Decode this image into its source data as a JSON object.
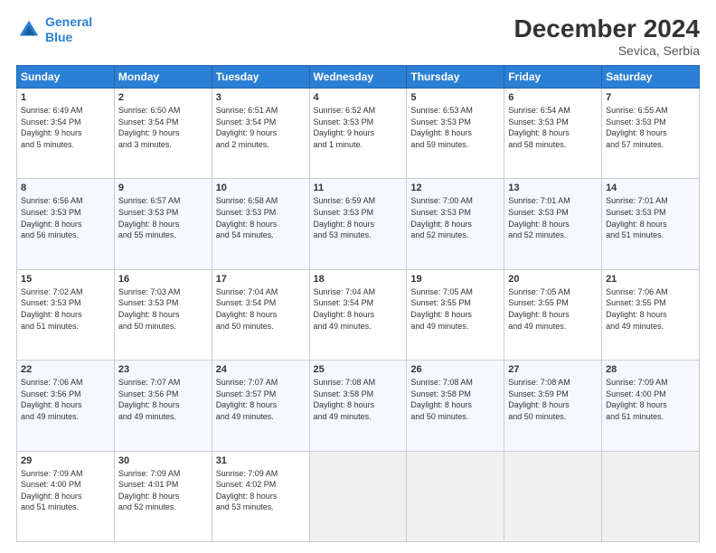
{
  "header": {
    "logo_line1": "General",
    "logo_line2": "Blue",
    "title": "December 2024",
    "subtitle": "Sevica, Serbia"
  },
  "days_of_week": [
    "Sunday",
    "Monday",
    "Tuesday",
    "Wednesday",
    "Thursday",
    "Friday",
    "Saturday"
  ],
  "weeks": [
    [
      {
        "day": 1,
        "info": "Sunrise: 6:49 AM\nSunset: 3:54 PM\nDaylight: 9 hours\nand 5 minutes."
      },
      {
        "day": 2,
        "info": "Sunrise: 6:50 AM\nSunset: 3:54 PM\nDaylight: 9 hours\nand 3 minutes."
      },
      {
        "day": 3,
        "info": "Sunrise: 6:51 AM\nSunset: 3:54 PM\nDaylight: 9 hours\nand 2 minutes."
      },
      {
        "day": 4,
        "info": "Sunrise: 6:52 AM\nSunset: 3:53 PM\nDaylight: 9 hours\nand 1 minute."
      },
      {
        "day": 5,
        "info": "Sunrise: 6:53 AM\nSunset: 3:53 PM\nDaylight: 8 hours\nand 59 minutes."
      },
      {
        "day": 6,
        "info": "Sunrise: 6:54 AM\nSunset: 3:53 PM\nDaylight: 8 hours\nand 58 minutes."
      },
      {
        "day": 7,
        "info": "Sunrise: 6:55 AM\nSunset: 3:53 PM\nDaylight: 8 hours\nand 57 minutes."
      }
    ],
    [
      {
        "day": 8,
        "info": "Sunrise: 6:56 AM\nSunset: 3:53 PM\nDaylight: 8 hours\nand 56 minutes."
      },
      {
        "day": 9,
        "info": "Sunrise: 6:57 AM\nSunset: 3:53 PM\nDaylight: 8 hours\nand 55 minutes."
      },
      {
        "day": 10,
        "info": "Sunrise: 6:58 AM\nSunset: 3:53 PM\nDaylight: 8 hours\nand 54 minutes."
      },
      {
        "day": 11,
        "info": "Sunrise: 6:59 AM\nSunset: 3:53 PM\nDaylight: 8 hours\nand 53 minutes."
      },
      {
        "day": 12,
        "info": "Sunrise: 7:00 AM\nSunset: 3:53 PM\nDaylight: 8 hours\nand 52 minutes."
      },
      {
        "day": 13,
        "info": "Sunrise: 7:01 AM\nSunset: 3:53 PM\nDaylight: 8 hours\nand 52 minutes."
      },
      {
        "day": 14,
        "info": "Sunrise: 7:01 AM\nSunset: 3:53 PM\nDaylight: 8 hours\nand 51 minutes."
      }
    ],
    [
      {
        "day": 15,
        "info": "Sunrise: 7:02 AM\nSunset: 3:53 PM\nDaylight: 8 hours\nand 51 minutes."
      },
      {
        "day": 16,
        "info": "Sunrise: 7:03 AM\nSunset: 3:53 PM\nDaylight: 8 hours\nand 50 minutes."
      },
      {
        "day": 17,
        "info": "Sunrise: 7:04 AM\nSunset: 3:54 PM\nDaylight: 8 hours\nand 50 minutes."
      },
      {
        "day": 18,
        "info": "Sunrise: 7:04 AM\nSunset: 3:54 PM\nDaylight: 8 hours\nand 49 minutes."
      },
      {
        "day": 19,
        "info": "Sunrise: 7:05 AM\nSunset: 3:55 PM\nDaylight: 8 hours\nand 49 minutes."
      },
      {
        "day": 20,
        "info": "Sunrise: 7:05 AM\nSunset: 3:55 PM\nDaylight: 8 hours\nand 49 minutes."
      },
      {
        "day": 21,
        "info": "Sunrise: 7:06 AM\nSunset: 3:55 PM\nDaylight: 8 hours\nand 49 minutes."
      }
    ],
    [
      {
        "day": 22,
        "info": "Sunrise: 7:06 AM\nSunset: 3:56 PM\nDaylight: 8 hours\nand 49 minutes."
      },
      {
        "day": 23,
        "info": "Sunrise: 7:07 AM\nSunset: 3:56 PM\nDaylight: 8 hours\nand 49 minutes."
      },
      {
        "day": 24,
        "info": "Sunrise: 7:07 AM\nSunset: 3:57 PM\nDaylight: 8 hours\nand 49 minutes."
      },
      {
        "day": 25,
        "info": "Sunrise: 7:08 AM\nSunset: 3:58 PM\nDaylight: 8 hours\nand 49 minutes."
      },
      {
        "day": 26,
        "info": "Sunrise: 7:08 AM\nSunset: 3:58 PM\nDaylight: 8 hours\nand 50 minutes."
      },
      {
        "day": 27,
        "info": "Sunrise: 7:08 AM\nSunset: 3:59 PM\nDaylight: 8 hours\nand 50 minutes."
      },
      {
        "day": 28,
        "info": "Sunrise: 7:09 AM\nSunset: 4:00 PM\nDaylight: 8 hours\nand 51 minutes."
      }
    ],
    [
      {
        "day": 29,
        "info": "Sunrise: 7:09 AM\nSunset: 4:00 PM\nDaylight: 8 hours\nand 51 minutes."
      },
      {
        "day": 30,
        "info": "Sunrise: 7:09 AM\nSunset: 4:01 PM\nDaylight: 8 hours\nand 52 minutes."
      },
      {
        "day": 31,
        "info": "Sunrise: 7:09 AM\nSunset: 4:02 PM\nDaylight: 8 hours\nand 53 minutes."
      },
      {
        "day": null,
        "info": ""
      },
      {
        "day": null,
        "info": ""
      },
      {
        "day": null,
        "info": ""
      },
      {
        "day": null,
        "info": ""
      }
    ]
  ]
}
